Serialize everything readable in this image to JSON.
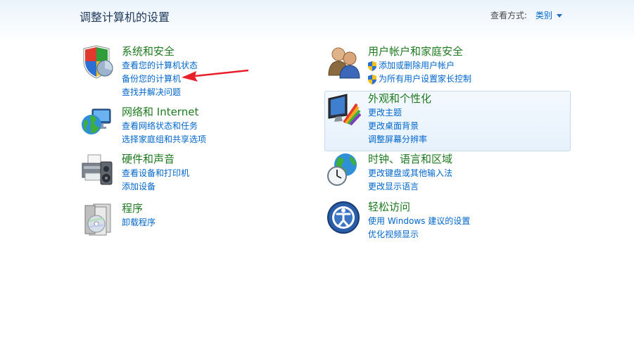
{
  "header": {
    "title": "调整计算机的设置",
    "view_by_label": "查看方式:",
    "view_by_value": "类别"
  },
  "left": [
    {
      "title": "系统和安全",
      "icon": "shield-icon",
      "links": [
        "查看您的计算机状态",
        "备份您的计算机",
        "查找并解决问题"
      ]
    },
    {
      "title": "网络和 Internet",
      "icon": "network-globe-icon",
      "links": [
        "查看网络状态和任务",
        "选择家庭组和共享选项"
      ]
    },
    {
      "title": "硬件和声音",
      "icon": "printer-speaker-icon",
      "links": [
        "查看设备和打印机",
        "添加设备"
      ]
    },
    {
      "title": "程序",
      "icon": "programs-disc-icon",
      "links": [
        "卸载程序"
      ]
    }
  ],
  "right": [
    {
      "title": "用户帐户和家庭安全",
      "icon": "users-icon",
      "links": [
        "添加或删除用户帐户",
        "为所有用户设置家长控制"
      ]
    },
    {
      "title": "外观和个性化",
      "icon": "display-color-icon",
      "links": [
        "更改主题",
        "更改桌面背景",
        "调整屏幕分辨率"
      ]
    },
    {
      "title": "时钟、语言和区域",
      "icon": "clock-globe-icon",
      "links": [
        "更改键盘或其他输入法",
        "更改显示语言"
      ]
    },
    {
      "title": "轻松访问",
      "icon": "ease-of-access-icon",
      "links": [
        "使用 Windows 建议的设置",
        "优化视频显示"
      ]
    }
  ],
  "colors": {
    "title_green": "#1e7a1e",
    "link_blue": "#0066cc",
    "arrow_red": "#e8202a"
  }
}
